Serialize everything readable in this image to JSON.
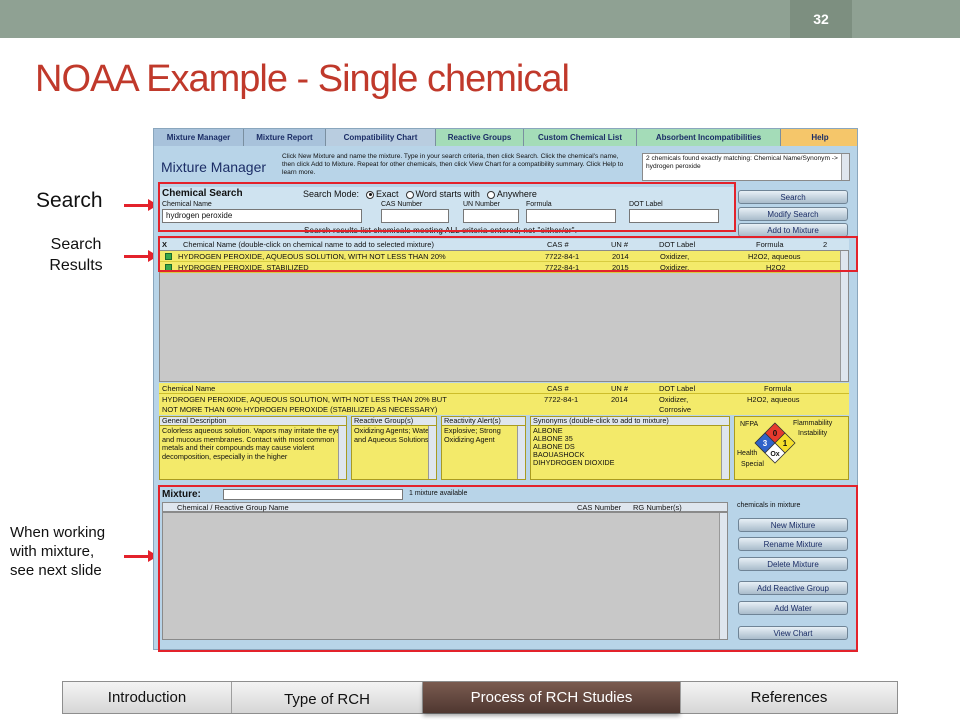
{
  "slide": {
    "page_number": "32",
    "title": "NOAA Example - Single chemical",
    "labels": {
      "search": "Search",
      "results_line1": "Search",
      "results_line2": "Results",
      "mixture": "When working with mixture, see next slide"
    }
  },
  "app": {
    "tabs": [
      "Mixture Manager",
      "Mixture Report",
      "Compatibility Chart",
      "Reactive Groups",
      "Custom Chemical List",
      "Absorbent Incompatibilities",
      "Help"
    ],
    "title": "Mixture Manager",
    "help_text": "Click New Mixture and name the mixture. Type in your search criteria, then click Search. Click the chemical's name, then click Add to Mixture. Repeat for other chemicals, then click View Chart for a compatibility summary. Click Help to learn more.",
    "found_text": "2 chemicals found exactly matching: Chemical Name/Synonym -> hydrogen peroxide",
    "search": {
      "heading": "Chemical Search",
      "mode_label": "Search Mode:",
      "modes": [
        "Exact",
        "Word starts with",
        "Anywhere"
      ],
      "fields": {
        "chemical_name_label": "Chemical Name",
        "chemical_name_value": "hydrogen peroxide",
        "cas_label": "CAS Number",
        "un_label": "UN Number",
        "formula_label": "Formula",
        "dot_label": "DOT Label"
      },
      "note": "Search results list chemicals meeting ALL criteria entered; not \"either/or\"."
    },
    "buttons": {
      "search": "Search",
      "modify": "Modify Search",
      "add_to_mixture": "Add to Mixture",
      "new_mixture": "New Mixture",
      "rename_mixture": "Rename Mixture",
      "delete_mixture": "Delete  Mixture",
      "add_reactive_group": "Add Reactive Group",
      "add_water": "Add Water",
      "view_chart": "View Chart"
    },
    "results": {
      "x": "X",
      "name_header": "Chemical Name (double-click on chemical name to add to selected mixture)",
      "cas_header": "CAS #",
      "un_header": "UN #",
      "dot_header": "DOT Label",
      "formula_header": "Formula",
      "count": "2",
      "rows": [
        {
          "name": "HYDROGEN PEROXIDE, AQUEOUS SOLUTION, WITH NOT LESS THAN 20%",
          "cas": "7722-84-1",
          "un": "2014",
          "dot": "Oxidizer,",
          "formula": "H2O2, aqueous"
        },
        {
          "name": "HYDROGEN PEROXIDE, STABILIZED",
          "cas": "7722-84-1",
          "un": "2015",
          "dot": "Oxidizer,",
          "formula": "H2O2"
        }
      ]
    },
    "detail": {
      "name_header": "Chemical Name",
      "cas_header": "CAS #",
      "un_header": "UN #",
      "dot_header": "DOT Label",
      "formula_header": "Formula",
      "name_line1": "HYDROGEN PEROXIDE, AQUEOUS SOLUTION, WITH NOT LESS THAN 20% BUT",
      "name_line2": "NOT MORE THAN 60% HYDROGEN PEROXIDE (STABILIZED AS NECESSARY)",
      "cas": "7722-84-1",
      "un": "2014",
      "dot_line1": "Oxidizer,",
      "dot_line2": "Corrosive",
      "formula": "H2O2, aqueous",
      "general_header": "General Description",
      "general_text": "Colorless aqueous solution. Vapors may irritate the eyes and mucous membranes. Contact with most common metals and their compounds may cause violent decomposition, especially in the higher",
      "reactive_header": "Reactive Group(s)",
      "reactive_text": "Oxidizing Agents; Water and Aqueous Solutions",
      "alert_header": "Reactivity Alert(s)",
      "alert_text": "Explosive; Strong Oxidizing Agent",
      "synonyms_header": "Synonyms (double-click to add to mixture)",
      "synonyms": [
        "ALBONE",
        "ALBONE 35",
        "ALBONE DS",
        "BAOUASHOCK",
        "DIHYDROGEN DIOXIDE"
      ],
      "nfpa": {
        "label": "NFPA",
        "flammability": "Flammability",
        "instability": "Instability",
        "health": "Health",
        "special": "Special",
        "health_value": "3",
        "flammability_value": "0",
        "instability_value": "1",
        "special_value": "Ox"
      }
    },
    "mixture": {
      "label": "Mixture:",
      "count_text": "1 mixture available",
      "chemicals_label": "chemicals in mixture",
      "col_name": "Chemical / Reactive Group Name",
      "col_cas": "CAS Number",
      "col_rg": "RG Number(s)"
    }
  },
  "nav": [
    "Introduction",
    "Type of RCH",
    "Process of RCH Studies",
    "References"
  ],
  "colors": {
    "accent_red": "#e3222b",
    "title_red": "#c0392b",
    "highlight_yellow": "#f3ea6a",
    "nav_active": "#5e443b"
  }
}
